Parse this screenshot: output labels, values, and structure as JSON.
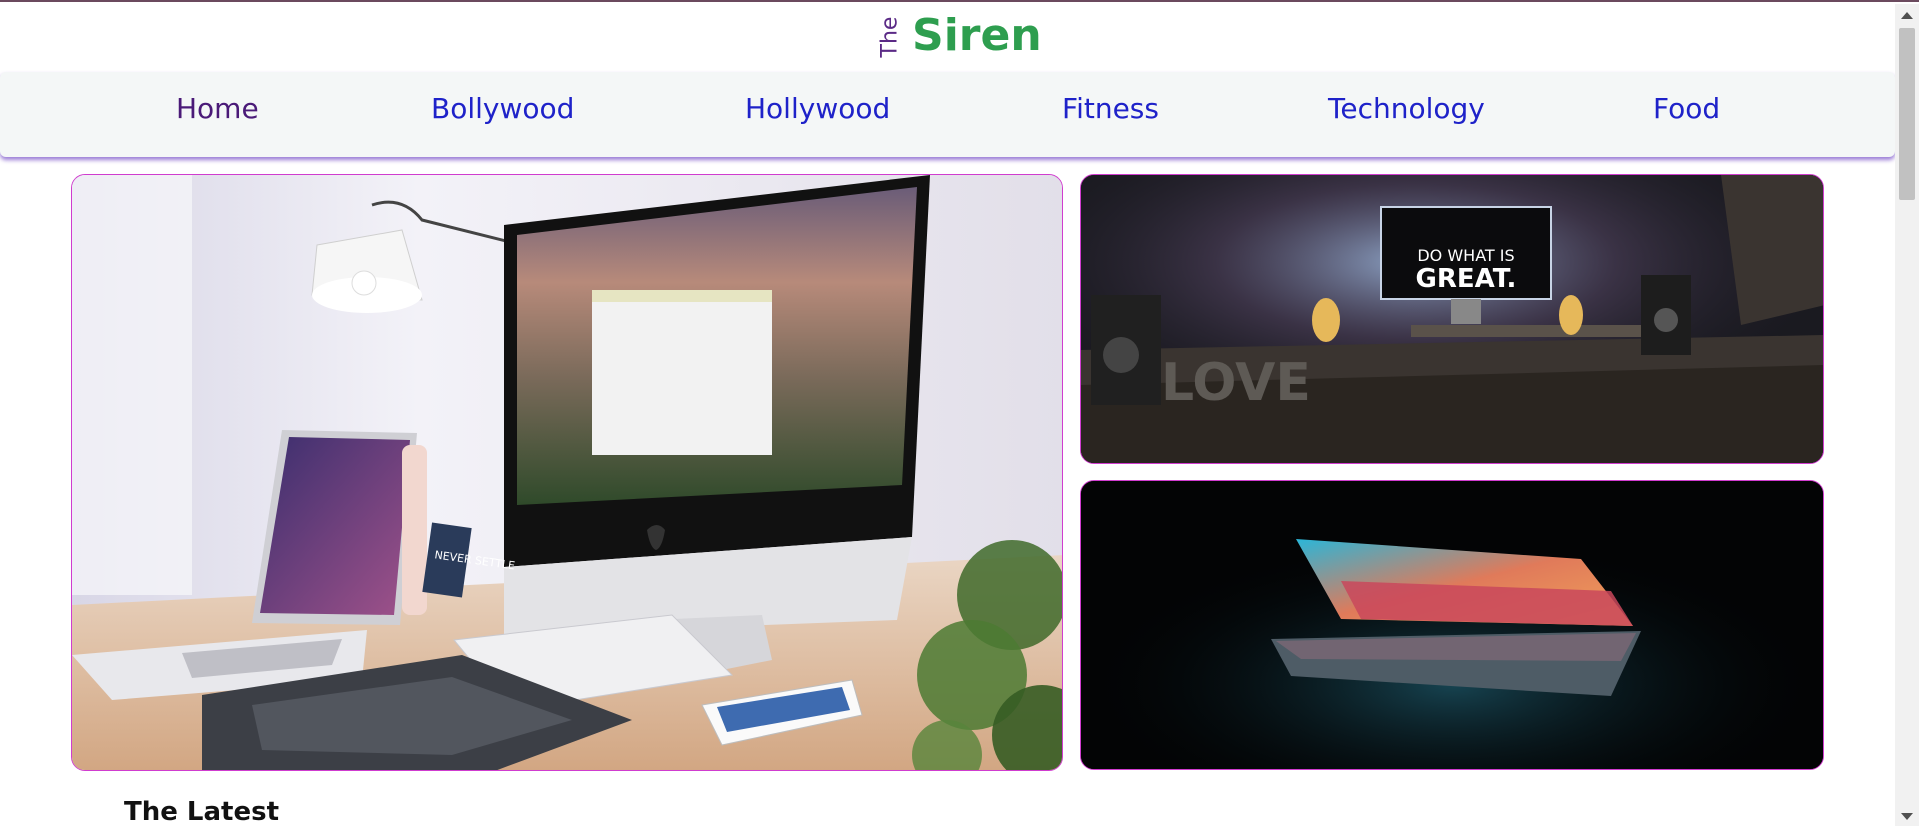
{
  "logo": {
    "the": "The",
    "siren": "Siren"
  },
  "nav": {
    "items": [
      {
        "label": "Home",
        "active": true
      },
      {
        "label": "Bollywood"
      },
      {
        "label": "Hollywood"
      },
      {
        "label": "Fitness"
      },
      {
        "label": "Technology"
      },
      {
        "label": "Food"
      }
    ]
  },
  "hero": {
    "main_image": "desk-imac-laptop-photo",
    "top_right_image": "do-what-is-great-monitor-photo",
    "top_right_text_line1": "DO WHAT IS",
    "top_right_text_line2": "GREAT.",
    "top_right_desk_text": "LOVE",
    "bottom_right_image": "glowing-laptop-photo",
    "main_postit_text": "NEVER SETTLE"
  },
  "sections": {
    "latest_title": "The Latest"
  },
  "colors": {
    "brand_green": "#2e9e4f",
    "brand_purple": "#5b2a86",
    "nav_link": "#1e22c9",
    "card_border": "#d03ccf"
  }
}
